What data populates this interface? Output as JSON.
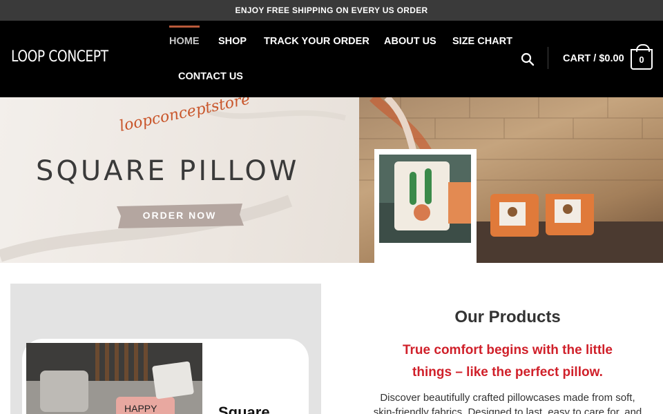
{
  "topbar": {
    "text": "ENJOY FREE SHIPPING ON EVERY US ORDER"
  },
  "header": {
    "logo": "LOOP CONCEPT",
    "nav": [
      "HOME",
      "SHOP",
      "TRACK YOUR ORDER",
      "ABOUT US",
      "SIZE CHART",
      "CONTACT US"
    ],
    "active_nav": "HOME",
    "cart_label": "CART / $0.00",
    "cart_count": "0",
    "search_icon": "search-icon"
  },
  "hero": {
    "script": "loopconceptstore",
    "title": "SQUARE PILLOW",
    "button": "ORDER NOW"
  },
  "feature": {
    "card_word": "Square",
    "pillow_text": "HAPPY"
  },
  "products": {
    "title": "Our Products",
    "tagline_line1": "True comfort begins with the little",
    "tagline_line2": "things – like the perfect pillow.",
    "desc_line1": "Discover beautifully crafted pillowcases made from soft,",
    "desc_line2": "skin-friendly fabrics. Designed to last, easy to care for, and"
  },
  "colors": {
    "accent": "#b9593a",
    "tagline": "#d0202a",
    "topbar": "#3a3a3a",
    "header": "#000000"
  }
}
